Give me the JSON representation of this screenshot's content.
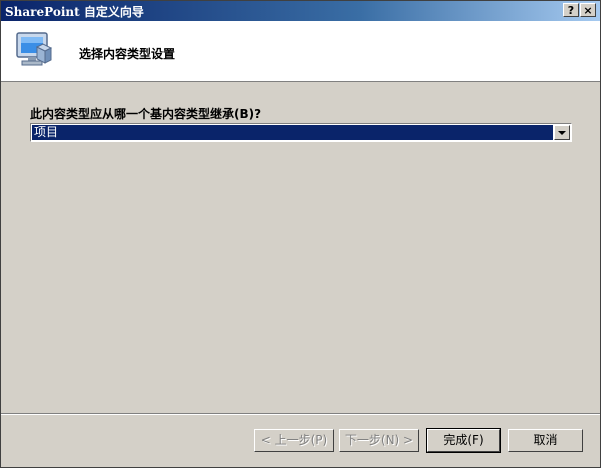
{
  "window": {
    "title": "SharePoint 自定义向导",
    "help_label": "?",
    "close_label": "×"
  },
  "header": {
    "title": "选择内容类型设置"
  },
  "form": {
    "question": "此内容类型应从哪一个基内容类型继承(B)?",
    "selected_value": "项目"
  },
  "buttons": {
    "back": "< 上一步(P)",
    "next": "下一步(N) >",
    "finish": "完成(F)",
    "cancel": "取消"
  }
}
